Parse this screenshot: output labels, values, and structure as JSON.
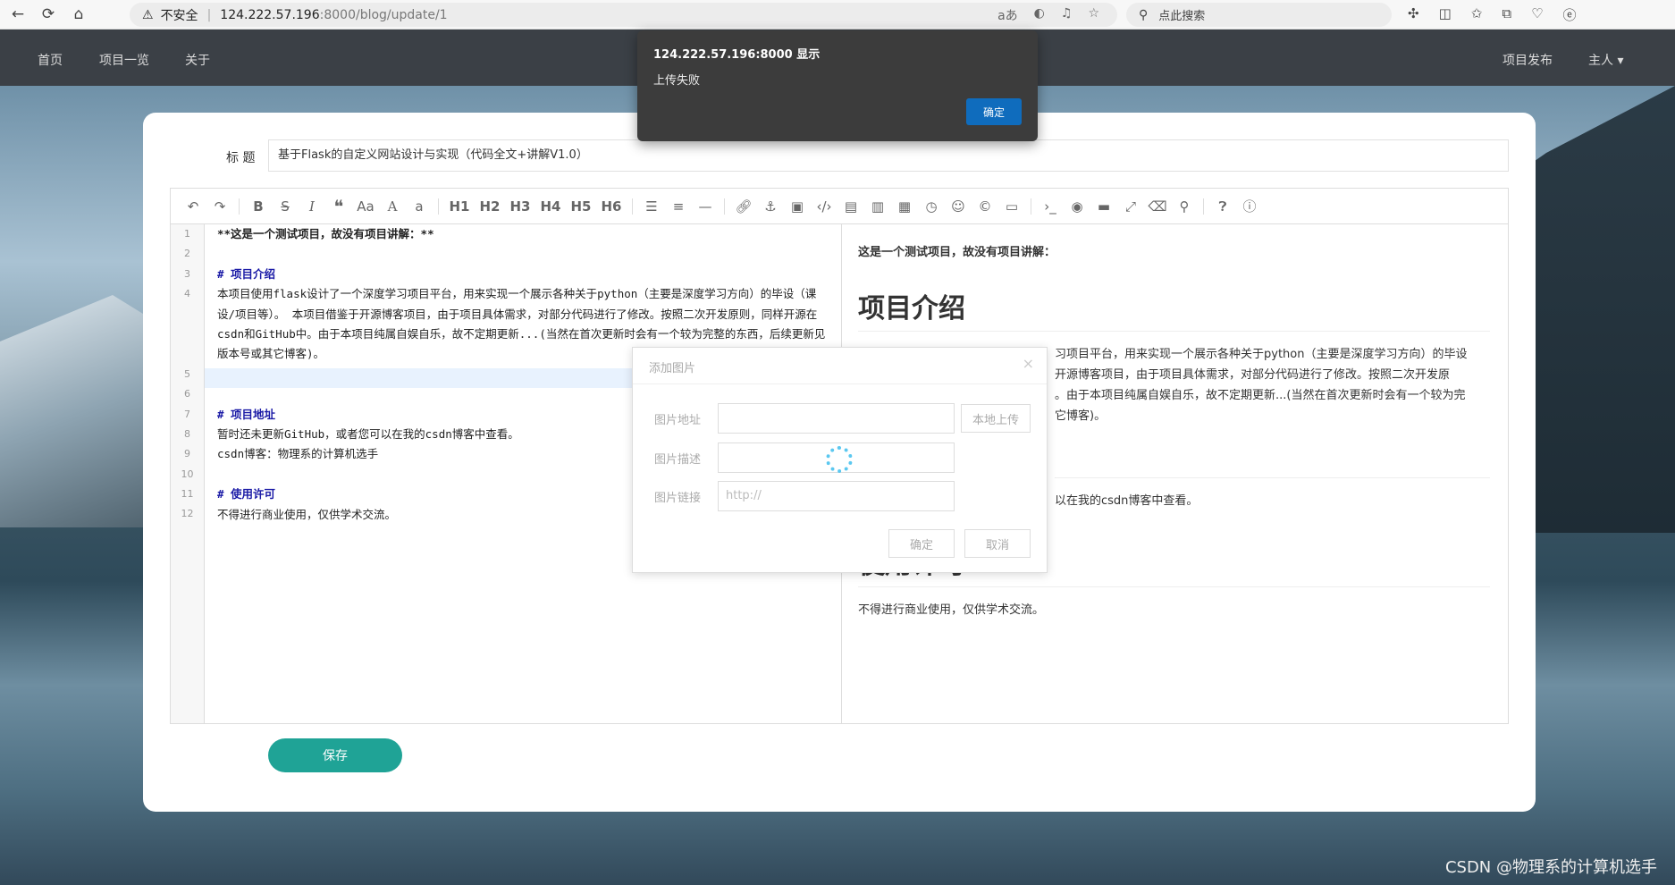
{
  "browser": {
    "security": "不安全",
    "host": "124.222.57.196",
    "port_path": ":8000/blog/update/1",
    "search_placeholder": "点此搜索"
  },
  "nav": {
    "home": "首页",
    "projects": "项目一览",
    "about": "关于",
    "publish": "项目发布",
    "user": "主人 ▾"
  },
  "form": {
    "title_label": "标 题",
    "title_value": "基于Flask的自定义网站设计与实现（代码全文+讲解V1.0）",
    "save": "保存"
  },
  "toolbar": {
    "headings": [
      "H1",
      "H2",
      "H3",
      "H4",
      "H5",
      "H6"
    ]
  },
  "code": {
    "line_numbers": [
      "1",
      "2",
      "3",
      "4",
      "",
      "",
      "",
      "5",
      "6",
      "7",
      "8",
      "9",
      "10",
      "11",
      "12"
    ],
    "l1": "**这是一个测试项目，故没有项目讲解：**",
    "l3": "# 项目介绍",
    "l4": "本项目使用flask设计了一个深度学习项目平台，用来实现一个展示各种关于python（主要是深度学习方向）的毕设（课设/项目等）。 本项目借鉴于开源博客项目，由于项目具体需求，对部分代码进行了修改。按照二次开发原则，同样开源在csdn和GitHub中。由于本项目纯属自娱自乐，故不定期更新...(当然在首次更新时会有一个较为完整的东西，后续更新见版本号或其它博客)。",
    "l7": "# 项目地址",
    "l8": "暂时还未更新GitHub，或者您可以在我的csdn博客中查看。",
    "l9": "csdn博客：物理系的计算机选手",
    "l11": "# 使用许可",
    "l12": "不得进行商业使用，仅供学术交流。"
  },
  "preview": {
    "bold": "这是一个测试项目，故没有项目讲解：",
    "h1_intro": "项目介绍",
    "intro_1": "习项目平台，用来实现一个展示各种关于python（主要是深度学习方向）的毕设",
    "intro_2": "开源博客项目，由于项目具体需求，对部分代码进行了修改。按照二次开发原",
    "intro_3": "。由于本项目纯属自娱自乐，故不定期更新...(当然在首次更新时会有一个较为完",
    "intro_4": "它博客)。",
    "addr_text": "以在我的csdn博客中查看。",
    "h1_license": "使用许可",
    "license_text": "不得进行商业使用，仅供学术交流。"
  },
  "image_dialog": {
    "title": "添加图片",
    "close": "×",
    "url_label": "图片地址",
    "desc_label": "图片描述",
    "link_label": "图片链接",
    "link_placeholder": "http://",
    "upload": "本地上传",
    "ok": "确定",
    "cancel": "取消"
  },
  "alert": {
    "title": "124.222.57.196:8000 显示",
    "message": "上传失败",
    "ok": "确定"
  },
  "watermark": "CSDN @物理系的计算机选手"
}
